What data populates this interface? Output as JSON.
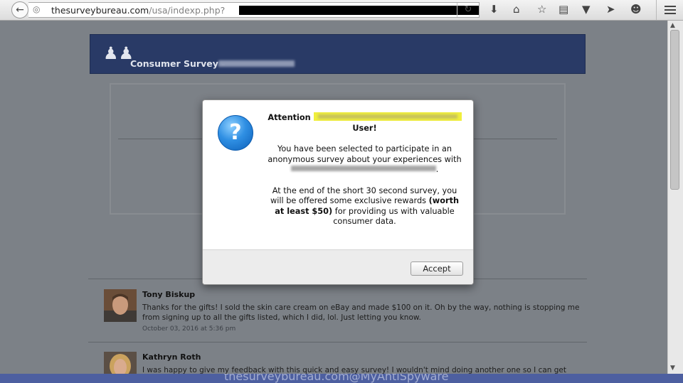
{
  "browser": {
    "url_host": "thesurveybureau.com",
    "url_path": "/usa/indexp.php?"
  },
  "banner": {
    "title": "Consumer Survey -"
  },
  "modal": {
    "attention_prefix": "Attention",
    "attention_suffix": "User!",
    "para1": "You have been selected to participate in an anonymous survey about your experiences with",
    "para1_end": ".",
    "para2_start": "At the end of the short 30 second survey, you will be offered some exclusive rewards",
    "para2_bold": "(worth at least $50)",
    "para2_end": "for providing us with valuable consumer data.",
    "accept_label": "Accept"
  },
  "comments": [
    {
      "name": "Tony Biskup",
      "text": "Thanks for the gifts! I sold the skin care cream on eBay and made $100 on it. Oh by the way, nothing is stopping me from signing up to all the gifts listed, which I did, lol. Just letting you know.",
      "date": "October 03, 2016 at 5:36 pm"
    },
    {
      "name": "Kathryn Roth",
      "text": "I was happy to give my feedback with this quick and easy survey! I wouldn't mind doing another one so I can get more"
    }
  ],
  "watermark": "thesurveybureau.com@MyAntiSpyware"
}
